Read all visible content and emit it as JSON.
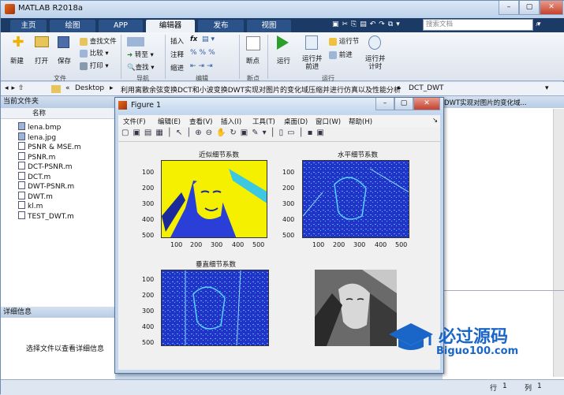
{
  "window": {
    "title": "MATLAB R2018a"
  },
  "tabs": [
    {
      "label": "主页"
    },
    {
      "label": "绘图"
    },
    {
      "label": "APP"
    },
    {
      "label": "编辑器"
    },
    {
      "label": "发布"
    },
    {
      "label": "视图"
    }
  ],
  "search": {
    "placeholder": "搜索文档"
  },
  "ribbon": {
    "file": {
      "new": "新建",
      "open": "打开",
      "save": "保存",
      "find_files": "查找文件",
      "compare": "比较",
      "print": "打印",
      "group": "文件"
    },
    "nav": {
      "goto": "转至",
      "find": "查找",
      "group": "导航"
    },
    "edit": {
      "insert": "插入",
      "comment": "注释",
      "indent": "缩进",
      "fx": "fx",
      "group": "编辑"
    },
    "breakpoints": {
      "label": "断点",
      "group": "断点"
    },
    "run": {
      "run": "运行",
      "run_advance": "运行并\n前进",
      "run_section": "运行节",
      "advance": "前进",
      "run_time": "运行并\n计时",
      "group": "运行"
    }
  },
  "address": {
    "parts": [
      "«",
      "Desktop",
      "利用离散余弦变换DCT和小波变换DWT实现对图片的变化域压缩并进行仿真以及性能分析",
      "DCT_DWT"
    ]
  },
  "current_folder": {
    "title": "当前文件夹",
    "col_name": "名称",
    "files": [
      "lena.bmp",
      "lena.jpg",
      "PSNR & MSE.m",
      "PSNR.m",
      "DCT-PSNR.m",
      "DCT.m",
      "DWT-PSNR.m",
      "DWT.m",
      "kl.m",
      "TEST_DWT.m"
    ]
  },
  "details": {
    "title": "详细信息",
    "message": "选择文件以查看详细信息"
  },
  "right_panel": {
    "snippet": "DWT实现对图片的变化域..."
  },
  "status": {
    "row_label": "行",
    "row": "1",
    "col_label": "列",
    "col": "1"
  },
  "figure": {
    "title": "Figure 1",
    "menu": [
      "文件(F)",
      "编辑(E)",
      "查看(V)",
      "插入(I)",
      "工具(T)",
      "桌面(D)",
      "窗口(W)",
      "帮助(H)"
    ],
    "plots": [
      {
        "title": "近似细节系数",
        "yticks": [
          "100",
          "200",
          "300",
          "400",
          "500"
        ],
        "xticks": [
          "100",
          "200",
          "300",
          "400",
          "500"
        ]
      },
      {
        "title": "水平细节系数",
        "yticks": [
          "100",
          "200",
          "300",
          "400",
          "500"
        ],
        "xticks": [
          "100",
          "200",
          "300",
          "400",
          "500"
        ]
      },
      {
        "title": "垂直细节系数",
        "yticks": [
          "100",
          "200",
          "300",
          "400",
          "500"
        ],
        "xticks": []
      },
      {
        "title": "",
        "yticks": [],
        "xticks": []
      }
    ]
  },
  "watermark": {
    "brand": "必过源码",
    "url": "Biguo100.com"
  },
  "colors": {
    "tab_bar": "#1b3a66",
    "accent_yellow": "#f5f000",
    "accent_blue": "#2a3fd8"
  }
}
